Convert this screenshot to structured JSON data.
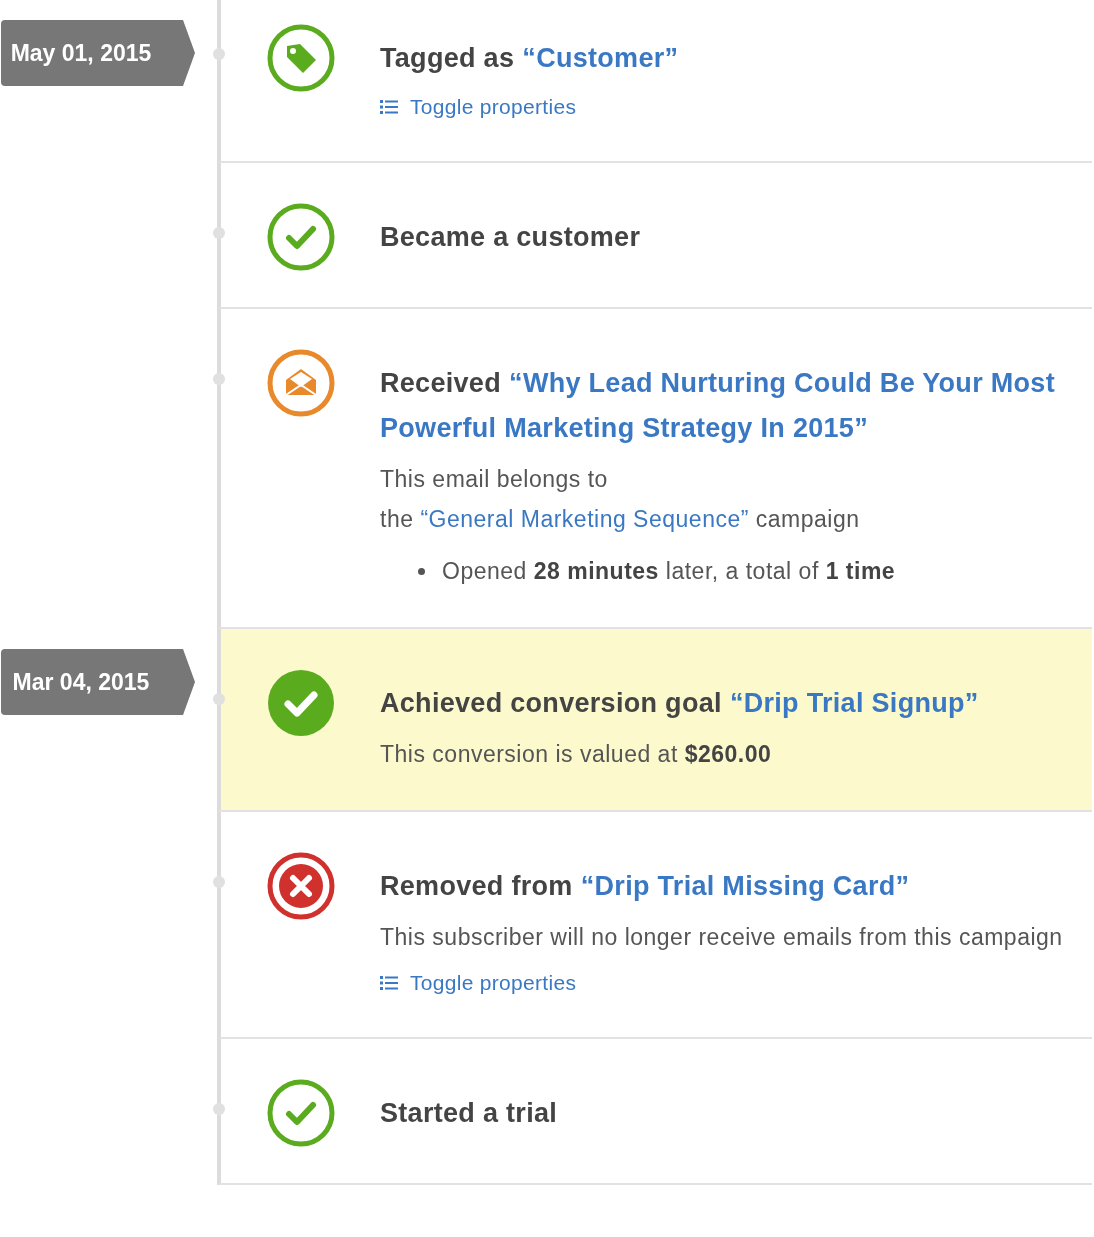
{
  "events": [
    {
      "kind": "tag",
      "date": "May 01, 2015",
      "title": "Tagged as",
      "link": "“Customer”",
      "highlighted": false,
      "toggle": "Toggle properties"
    },
    {
      "kind": "check",
      "title": "Became a customer",
      "highlighted": false
    },
    {
      "kind": "email",
      "title": "Received",
      "link": "“Why Lead Nurturing Could Be Your Most Powerful Marketing Strategy In 2015”",
      "highlighted": false,
      "description": {
        "text": "This email belongs to the",
        "link": "“General Marketing Sequence”",
        "after": "campaign"
      },
      "bullets": [
        "Opened **28 minutes** later, a total of **1 time**"
      ]
    },
    {
      "kind": "goal",
      "date": "Mar 04, 2015",
      "title": "Achieved conversion goal",
      "link": "“Drip Trial Signup”",
      "highlighted": true,
      "description": {
        "text": "This conversion is valued at **$260.00**"
      }
    },
    {
      "kind": "removed",
      "title": "Removed from",
      "link": "“Drip Trial Missing Card”",
      "highlighted": false,
      "description": {
        "text": "This subscriber will no longer receive emails from this campaign"
      },
      "toggle": "Toggle properties"
    },
    {
      "kind": "check",
      "title": "Started a trial",
      "highlighted": false
    }
  ]
}
